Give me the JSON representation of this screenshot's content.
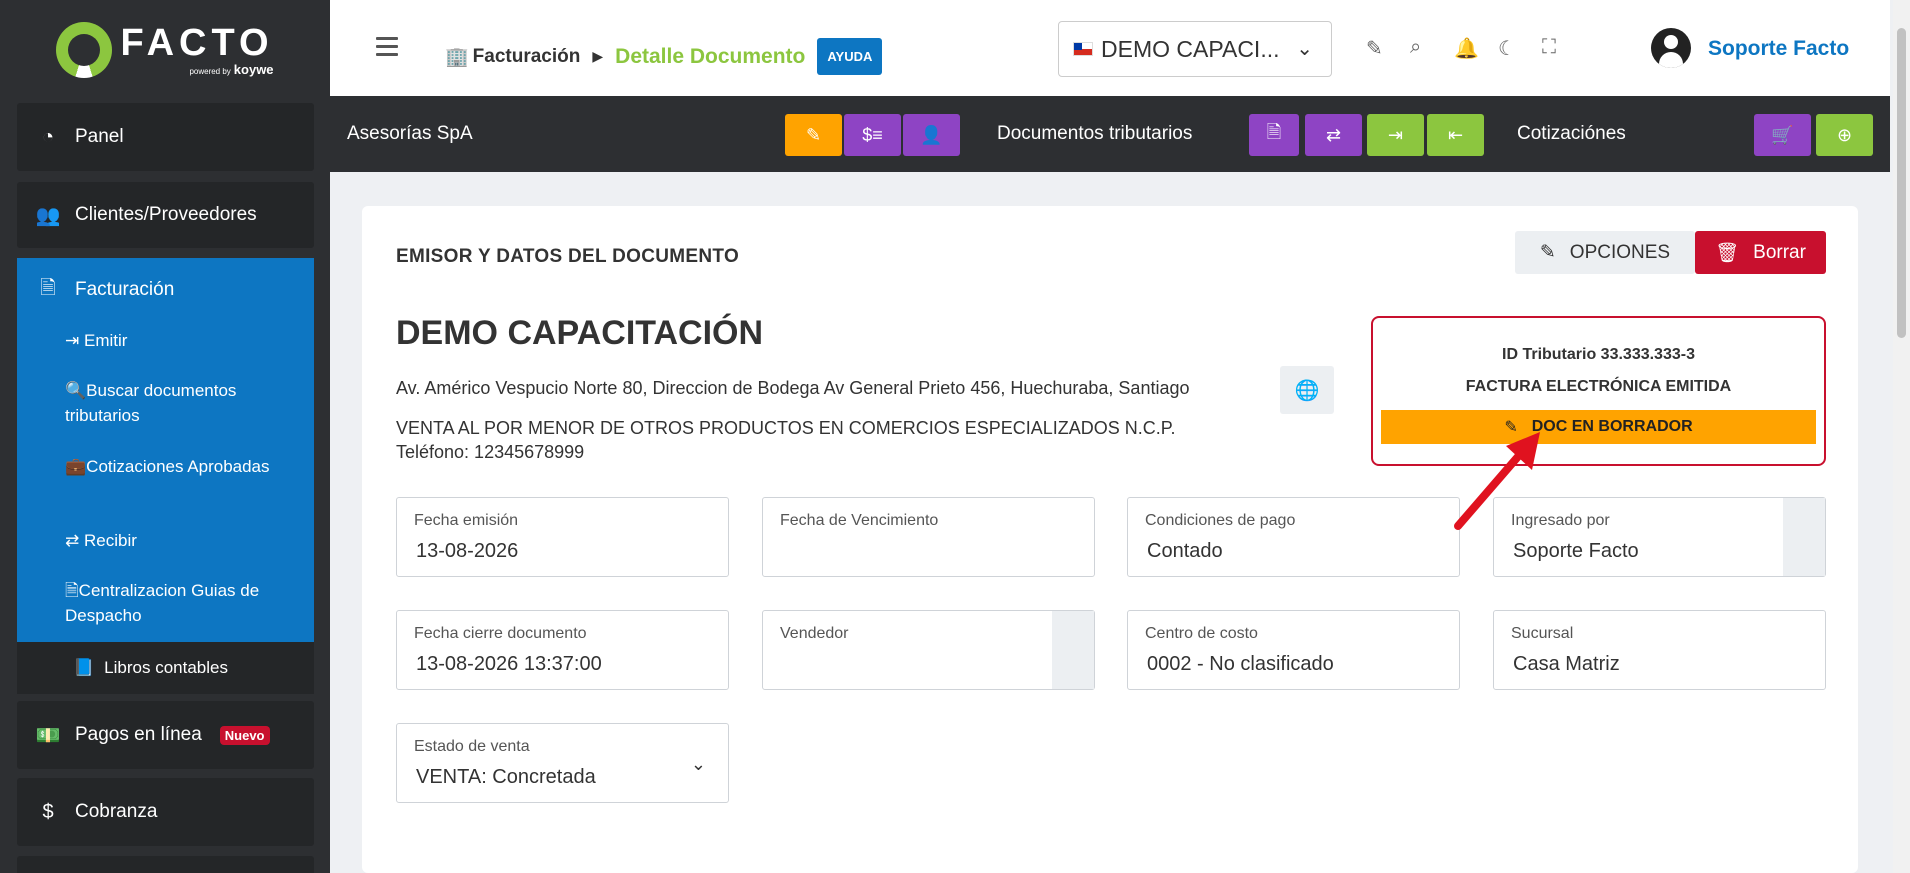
{
  "brand": {
    "name": "FACTO",
    "powered": "powered by",
    "partner": "koywe"
  },
  "sidebar": {
    "panel": "Panel",
    "clientes": "Clientes/Proveedores",
    "facturacion": "Facturación",
    "sub": {
      "emitir": "Emitir",
      "buscar": "Buscar documentos tributarios",
      "cotizaciones": "Cotizaciones Aprobadas",
      "recibir": "Recibir",
      "centralizacion": "Centralizacion Guias de Despacho"
    },
    "libros": "Libros contables",
    "pagos": "Pagos en línea",
    "pagos_badge": "Nuevo",
    "cobranza": "Cobranza"
  },
  "header": {
    "crumb_section": "Facturación",
    "crumb_page": "Detalle Documento",
    "help": "AYUDA",
    "company": "DEMO CAPACI...",
    "user": "Soporte Facto"
  },
  "actionbar": {
    "company_label": "Asesorías SpA",
    "docs_label": "Documentos tributarios",
    "quotes_label": "Cotizaciónes"
  },
  "card": {
    "title": "EMISOR Y DATOS DEL DOCUMENTO",
    "opciones": "OPCIONES",
    "borrar": "Borrar",
    "company_name": "DEMO CAPACITACIÓN",
    "address": "Av. Américo Vespucio Norte 80, Direccion de Bodega Av General Prieto 456, Huechuraba, Santiago",
    "activity": "VENTA AL POR MENOR DE OTROS PRODUCTOS EN COMERCIOS ESPECIALIZADOS N.C.P.",
    "phone": "Teléfono: 12345678999",
    "status": {
      "id": "ID Tributario 33.333.333-3",
      "doc_type": "FACTURA ELECTRÓNICA EMITIDA",
      "draft": "DOC EN BORRADOR"
    }
  },
  "fields": {
    "fecha_emision": {
      "label": "Fecha emisión",
      "value": "13-08-2026"
    },
    "fecha_vencimiento": {
      "label": "Fecha de Vencimiento",
      "value": ""
    },
    "condiciones": {
      "label": "Condiciones de pago",
      "value": "Contado"
    },
    "ingresado": {
      "label": "Ingresado por",
      "value": "Soporte Facto"
    },
    "fecha_cierre": {
      "label": "Fecha cierre documento",
      "value": "13-08-2026 13:37:00"
    },
    "vendedor": {
      "label": "Vendedor",
      "value": ""
    },
    "centro_costo": {
      "label": "Centro de costo",
      "value": "0002 - No clasificado"
    },
    "sucursal": {
      "label": "Sucursal",
      "value": "Casa Matriz"
    },
    "estado_venta": {
      "label": "Estado de venta",
      "value": "VENTA: Concretada"
    }
  },
  "colors": {
    "sidebar_bg": "#2d2f32",
    "active_blue": "#0d76c2",
    "accent_green": "#8cc63f",
    "orange": "#ffa300",
    "purple": "#8e44c4",
    "danger": "#c8102e"
  }
}
